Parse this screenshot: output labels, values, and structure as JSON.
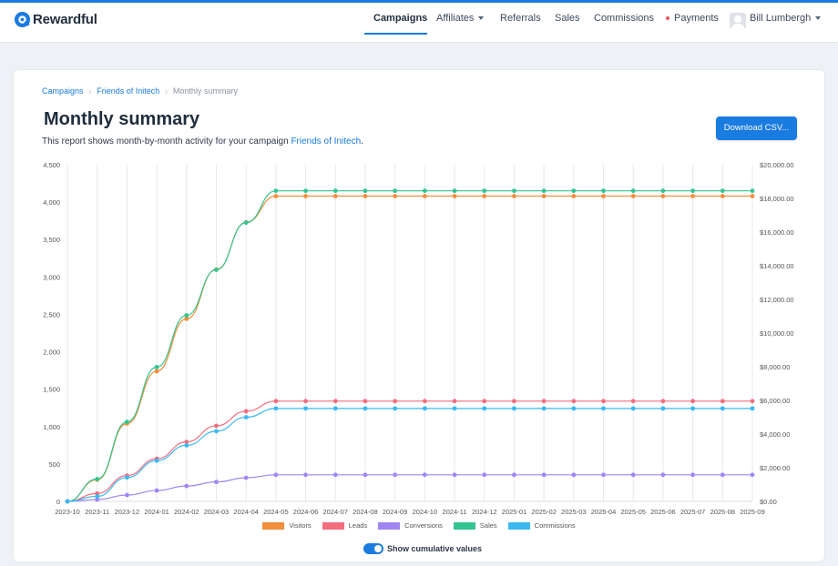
{
  "nav": {
    "brand": "Rewardful",
    "items": [
      "Campaigns",
      "Affiliates",
      "Referrals",
      "Sales",
      "Commissions",
      "Payments"
    ],
    "user": "Bill Lumbergh"
  },
  "breadcrumb": [
    "Campaigns",
    "Friends of Initech",
    "Monthly summary"
  ],
  "page": {
    "title": "Monthly summary",
    "desc_prefix": "This report shows month-by-month activity for your campaign ",
    "desc_link": "Friends of Initech",
    "desc_suffix": ".",
    "download_label": "Download CSV..."
  },
  "toggle": {
    "label": "Show cumulative values",
    "on": true
  },
  "chart_data": {
    "type": "line",
    "x": [
      "2023-10",
      "2023-11",
      "2023-12",
      "2024-01",
      "2024-02",
      "2024-03",
      "2024-04",
      "2024-05",
      "2024-06",
      "2024-07",
      "2024-08",
      "2024-09",
      "2024-10",
      "2024-11",
      "2024-12",
      "2025-01",
      "2025-02",
      "2025-03",
      "2025-04",
      "2025-05",
      "2025-06",
      "2025-07",
      "2025-08",
      "2025-09"
    ],
    "ylim_left": [
      0,
      4500
    ],
    "ylim_right": [
      0,
      20000
    ],
    "left_ticks": [
      "0",
      "500",
      "1,000",
      "1,500",
      "2,000",
      "2,500",
      "3,000",
      "3,500",
      "4,000",
      "4,500"
    ],
    "right_ticks": [
      "$0.00",
      "$2,000.00",
      "$4,000.00",
      "$6,000.00",
      "$8,000.00",
      "$10,000.00",
      "$12,000.00",
      "$14,000.00",
      "$16,000.00",
      "$18,000.00",
      "$20,000.00"
    ],
    "grid": "vertical",
    "legend_position": "bottom",
    "series": [
      {
        "name": "Visitors",
        "color": "#f28e3c",
        "axis": "left",
        "values": [
          0,
          290,
          1040,
          1740,
          2440,
          3100,
          3730,
          4080,
          4080,
          4080,
          4080,
          4080,
          4080,
          4080,
          4080,
          4080,
          4080,
          4080,
          4080,
          4080,
          4080,
          4080,
          4080,
          4080
        ]
      },
      {
        "name": "Leads",
        "color": "#f26d7d",
        "axis": "left",
        "values": [
          0,
          105,
          345,
          570,
          795,
          1010,
          1205,
          1340,
          1340,
          1340,
          1340,
          1340,
          1340,
          1340,
          1340,
          1340,
          1340,
          1340,
          1340,
          1340,
          1340,
          1340,
          1340,
          1340
        ]
      },
      {
        "name": "Conversions",
        "color": "#9f86f2",
        "axis": "left",
        "values": [
          0,
          25,
          85,
          145,
          205,
          260,
          315,
          355,
          355,
          355,
          355,
          355,
          355,
          355,
          355,
          355,
          355,
          355,
          355,
          355,
          355,
          355,
          355,
          355
        ]
      },
      {
        "name": "Sales",
        "color": "#34c48f",
        "axis": "right",
        "values": [
          0,
          1330,
          4720,
          7980,
          11050,
          13760,
          16560,
          18450,
          18450,
          18450,
          18450,
          18450,
          18450,
          18450,
          18450,
          18450,
          18450,
          18450,
          18450,
          18450,
          18450,
          18450,
          18450,
          18450
        ]
      },
      {
        "name": "Commissions",
        "color": "#3bb8f0",
        "axis": "right",
        "values": [
          0,
          300,
          1420,
          2420,
          3330,
          4170,
          5000,
          5520,
          5520,
          5520,
          5520,
          5520,
          5520,
          5520,
          5520,
          5520,
          5520,
          5520,
          5520,
          5520,
          5520,
          5520,
          5520,
          5520
        ]
      }
    ]
  }
}
